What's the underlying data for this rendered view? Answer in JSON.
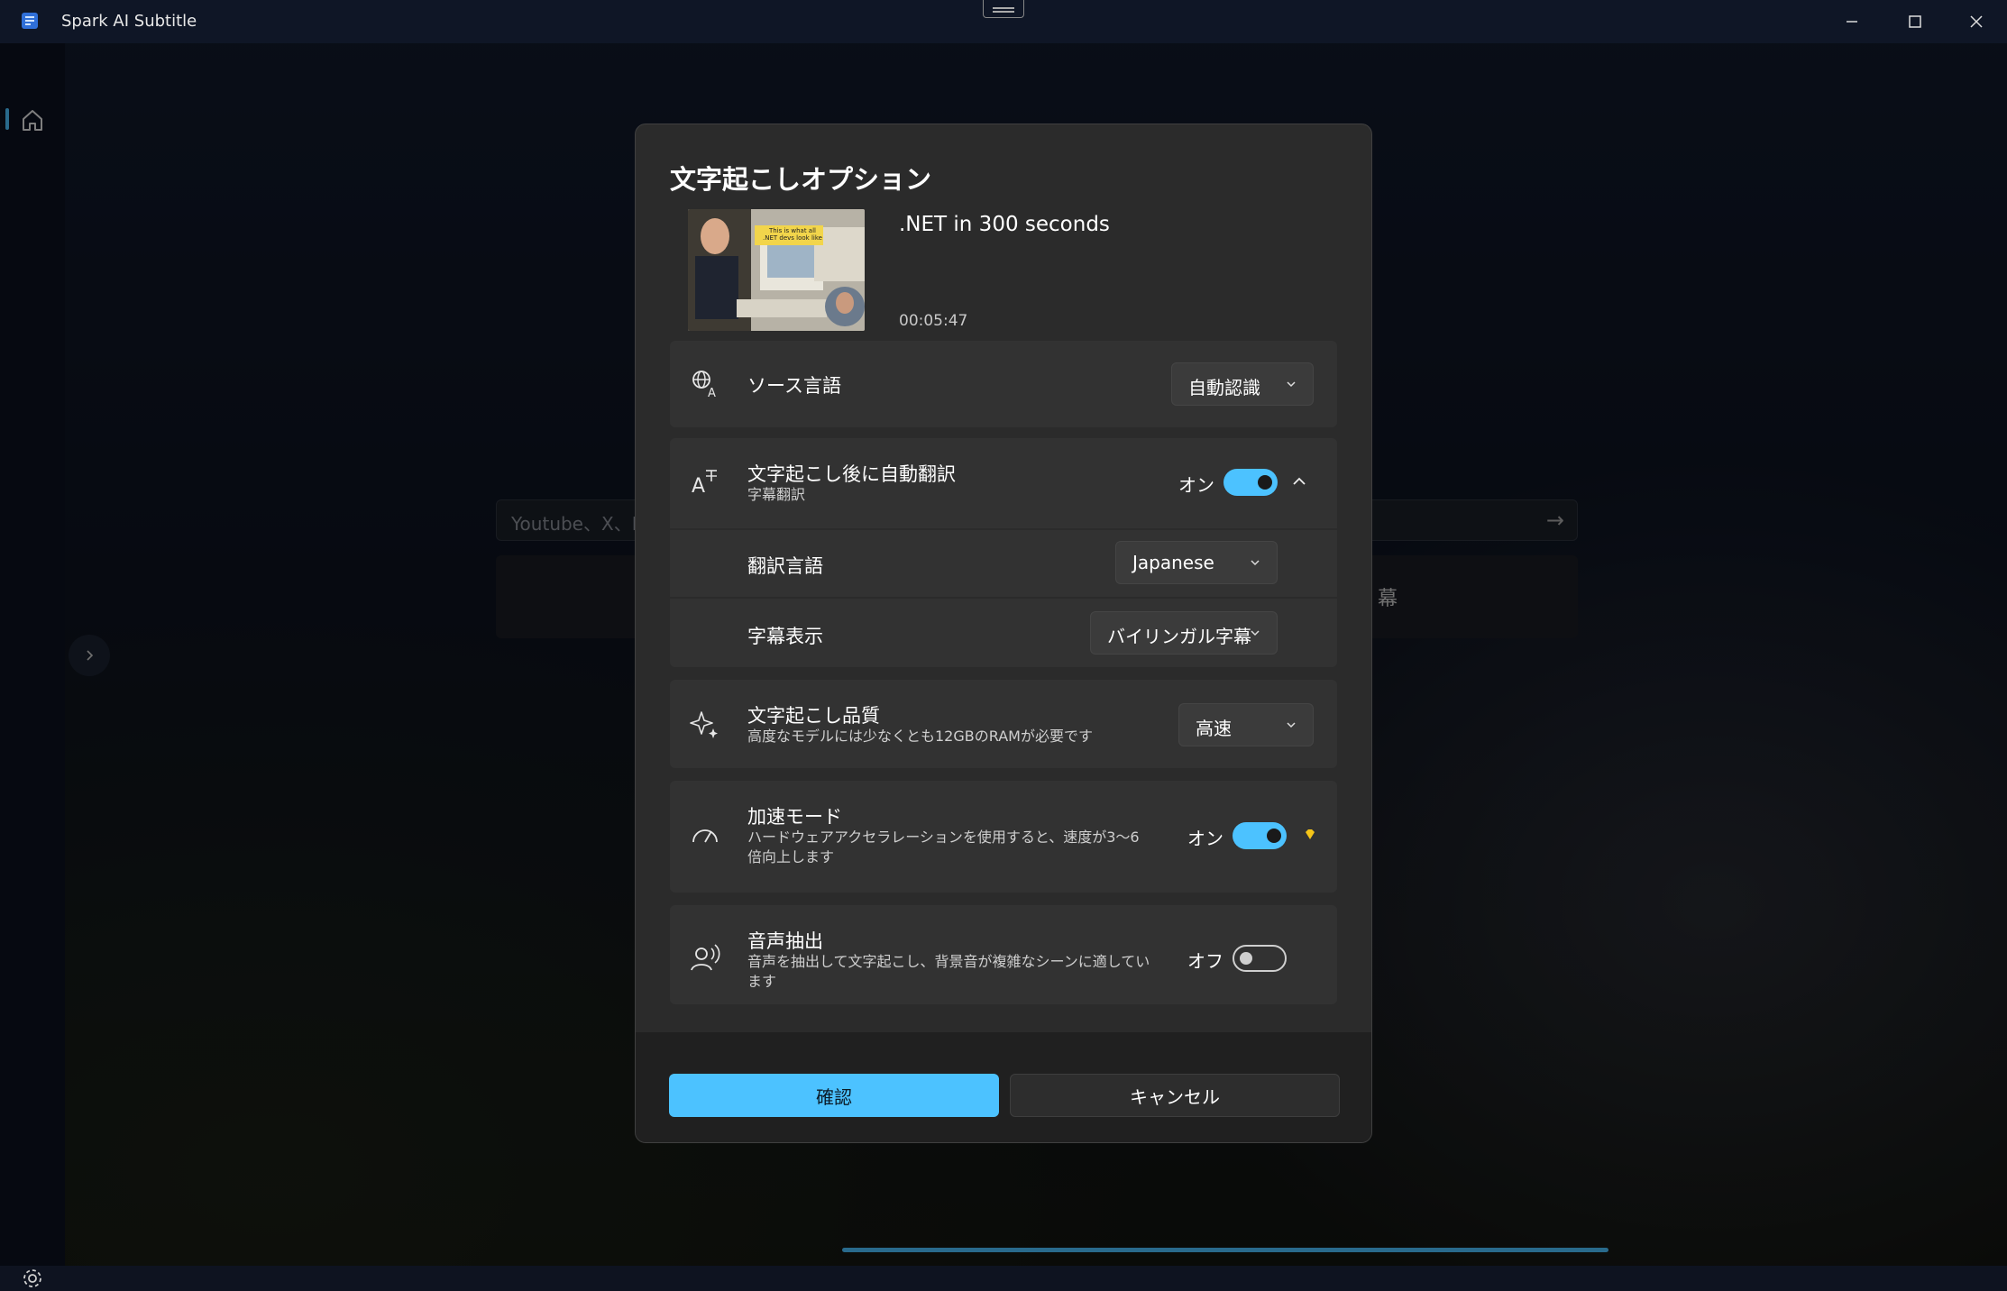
{
  "window": {
    "title": "Spark AI Subtitle"
  },
  "background": {
    "url_placeholder": "Youtube、X、Ins",
    "panel_text": "幕"
  },
  "dialog": {
    "title": "文字起こしオプション",
    "media": {
      "title": ".NET in 300 seconds",
      "duration": "00:05:47",
      "thumbnail_caption_1": "This is what all",
      "thumbnail_caption_2": ".NET devs look like"
    },
    "source_language": {
      "label": "ソース言語",
      "value": "自動認識"
    },
    "auto_translate": {
      "label": "文字起こし後に自動翻訳",
      "sublabel": "字幕翻訳",
      "state": "オン",
      "translate_language_label": "翻訳言語",
      "translate_language_value": "Japanese",
      "subtitle_display_label": "字幕表示",
      "subtitle_display_value": "バイリンガル字幕"
    },
    "quality": {
      "label": "文字起こし品質",
      "sublabel": "高度なモデルには少なくとも12GBのRAMが必要です",
      "value": "高速"
    },
    "acceleration": {
      "label": "加速モード",
      "sublabel": "ハードウェアアクセラレーションを使用すると、速度が3～6倍向上します",
      "state": "オン"
    },
    "voice_extraction": {
      "label": "音声抽出",
      "sublabel": "音声を抽出して文字起こし、背景音が複雑なシーンに適しています",
      "state": "オフ"
    },
    "confirm_label": "確認",
    "cancel_label": "キャンセル"
  },
  "colors": {
    "accent": "#4cc2ff",
    "premium": "#f5c518"
  }
}
